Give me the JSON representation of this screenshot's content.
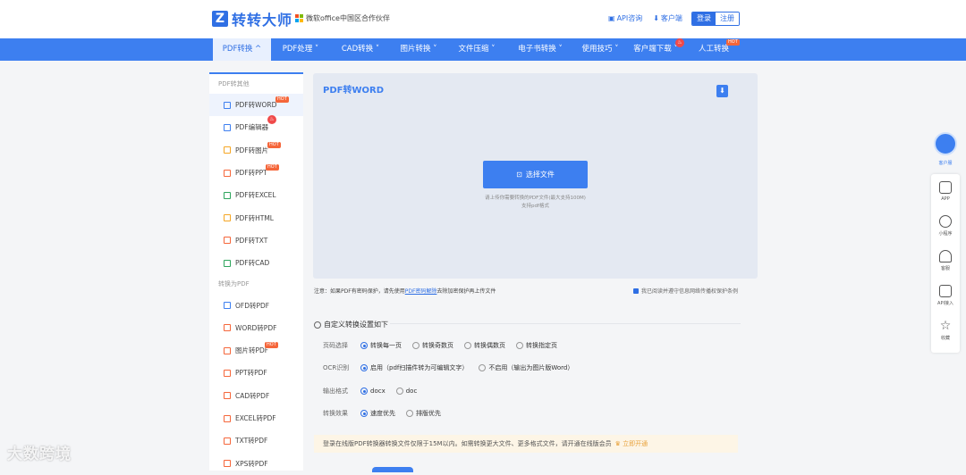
{
  "header": {
    "logo_mark": "Z",
    "logo_text": "转转大师",
    "partner_text": "微软office中国区合作伙伴",
    "api_link": "API咨询",
    "client_link": "客户端",
    "login": "登录",
    "register": "注册"
  },
  "nav": {
    "items": [
      {
        "label": "PDF转换 ^"
      },
      {
        "label": "PDF处理 ˅"
      },
      {
        "label": "CAD转换 ˅"
      },
      {
        "label": "图片转换 ˅"
      },
      {
        "label": "文件压缩 ˅"
      },
      {
        "label": "电子书转换 ˅"
      },
      {
        "label": "使用技巧 ˅"
      },
      {
        "label": "客户端下载 ˅"
      },
      {
        "label": "人工转换"
      }
    ],
    "hot": "HOT"
  },
  "sidebar": {
    "section1": "PDF转其他",
    "items1": [
      "PDF转WORD",
      "PDF编辑器",
      "PDF转图片",
      "PDF转PPT",
      "PDF转EXCEL",
      "PDF转HTML",
      "PDF转TXT",
      "PDF转CAD"
    ],
    "section2": "转换为PDF",
    "items2": [
      "OFD转PDF",
      "WORD转PDF",
      "图片转PDF",
      "PPT转PDF",
      "CAD转PDF",
      "EXCEL转PDF",
      "TXT转PDF",
      "XPS转PDF"
    ],
    "hot": "HOT"
  },
  "upload": {
    "title": "PDF转WORD",
    "choose_button": "选择文件",
    "hint_line1": "请上传你需要转换的PDF文件(最大支持100M)",
    "hint_line2": "支持pdf格式"
  },
  "note": {
    "prefix": "注意：如果PDF有密码保护，请先使用",
    "link": "PDF密码解除",
    "suffix": "去除加密保护再上传文件",
    "agree": "我已阅读并遵守信息网络传播权保护条例"
  },
  "settings": {
    "title": "自定义转换设置如下",
    "rows": [
      {
        "label": "页码选择",
        "options": [
          "转换每一页",
          "转换奇数页",
          "转换偶数页",
          "转换指定页"
        ]
      },
      {
        "label": "OCR识别",
        "options": [
          "启用（pdf扫描件转为可编辑文字）",
          "不启用（输出为图片版Word）"
        ]
      },
      {
        "label": "输出格式",
        "options": [
          "docx",
          "doc"
        ]
      },
      {
        "label": "转换效果",
        "options": [
          "速度优先",
          "排版优先"
        ]
      }
    ]
  },
  "promo": {
    "text": "登录在线版PDF转换器转换文件仅限于15M以内。如需转换更大文件、更多格式文件，请开通在线版会员",
    "action": "立即开通"
  },
  "rightbar": {
    "kefu": "客户服",
    "items": [
      "APP",
      "小程序",
      "客服",
      "API接入",
      "收藏"
    ]
  },
  "watermark": "大数跨境",
  "colors": {
    "primary": "#3d7ff0",
    "hot": "#f5663a",
    "fire": "#f04a4a"
  }
}
